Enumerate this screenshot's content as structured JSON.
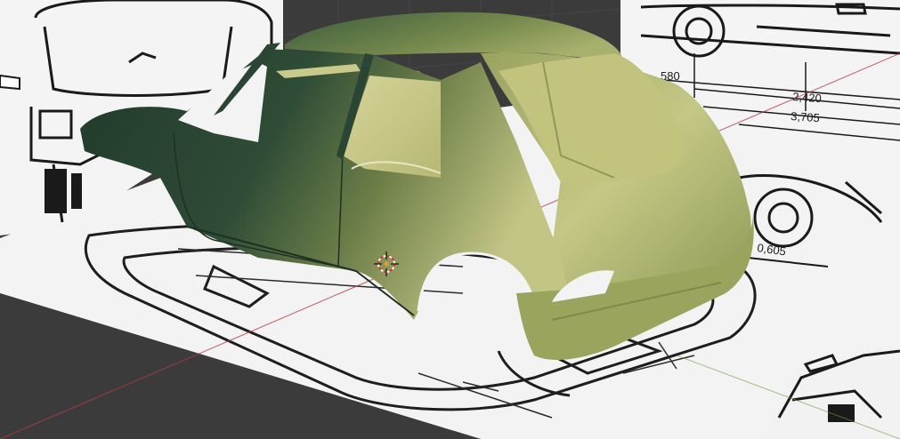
{
  "viewport": {
    "background": "#3b3b3b",
    "grid_color": "#4a4a4a",
    "x_axis_color": "#b23a48",
    "y_axis_color": "#6f9a3a"
  },
  "reference_images": {
    "front_blueprint": {
      "label": "front-view-reference"
    },
    "side_blueprint": {
      "label": "side-view-reference"
    },
    "top_blueprint": {
      "label": "top-view-reference"
    }
  },
  "dimensions": {
    "wheelbase": "2,420",
    "overall_length": "3,705",
    "front_partial": "580",
    "rear_overhang": "0,605"
  },
  "model": {
    "name": "car-body-mesh",
    "color_dark": "#2f4a37",
    "color_light": "#c2c57f"
  },
  "cursor": {
    "name": "3d-cursor"
  }
}
